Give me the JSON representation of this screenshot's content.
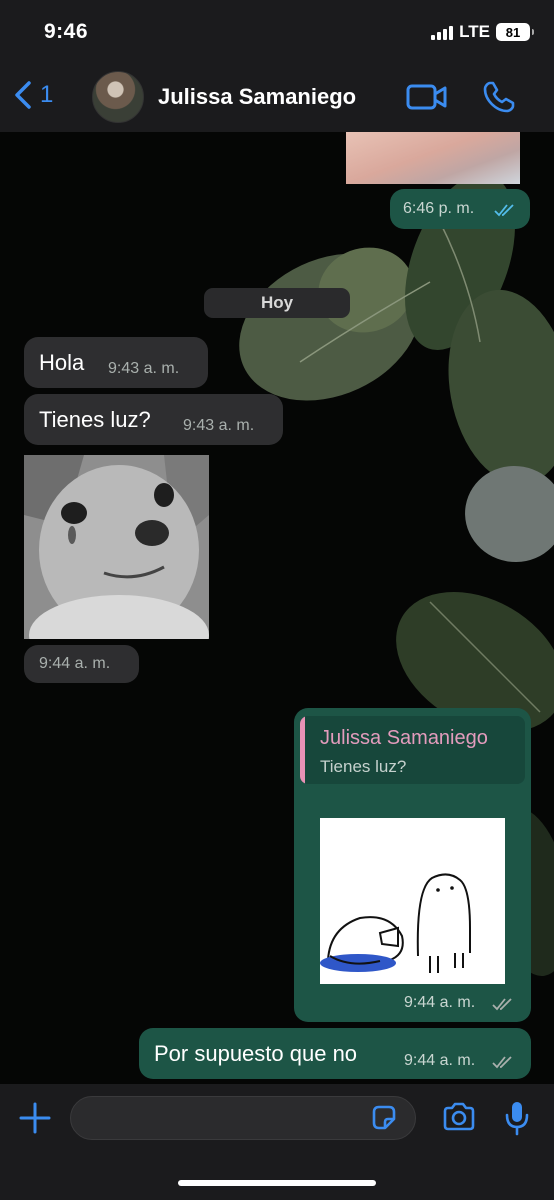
{
  "status_bar": {
    "time": "9:46",
    "network": "LTE",
    "battery": "81"
  },
  "header": {
    "back_count": "1",
    "contact_name": "Julissa Samaniego"
  },
  "messages": {
    "m0_time": "6:46 p. m.",
    "date_chip": "Hoy",
    "m1_text": "Hola",
    "m1_time": "9:43 a. m.",
    "m2_text": "Tienes luz?",
    "m2_time": "9:43 a. m.",
    "m3_time": "9:44 a. m.",
    "m4_reply_name": "Julissa Samaniego",
    "m4_reply_text": "Tienes luz?",
    "m4_time": "9:44 a. m.",
    "m5_text": "Por supuesto que no",
    "m5_time": "9:44 a. m."
  },
  "composer": {
    "value": "",
    "placeholder": ""
  },
  "colors": {
    "accent": "#3b8cf0",
    "outgoing_bubble": "#1d5546",
    "incoming_bubble": "#2e2e30",
    "reply_name": "#e39cbd",
    "read_ticks": "#53bdeb"
  },
  "icons": [
    "chevron-left-icon",
    "video-camera-icon",
    "phone-icon",
    "plus-icon",
    "sticker-icon",
    "camera-icon",
    "microphone-icon",
    "double-check-icon"
  ]
}
